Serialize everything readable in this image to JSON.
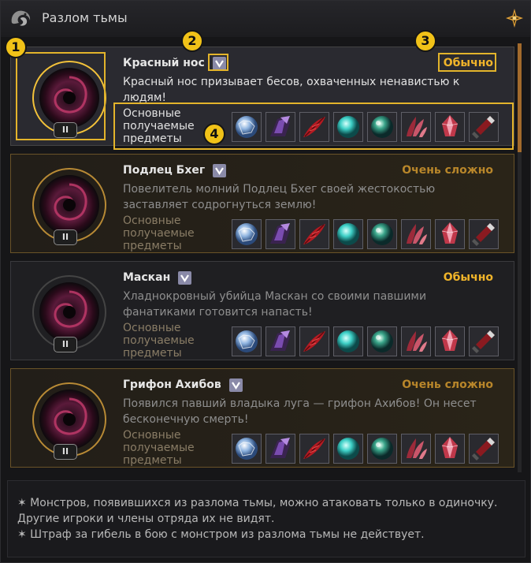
{
  "window": {
    "title": "Разлом тьмы",
    "logo_icon": "dragon-emblem-icon",
    "corner_icon": "compass-star-icon"
  },
  "colors": {
    "accent_gold": "#e3b42b",
    "normal": "#f0b42a",
    "very_hard": "#b8862a",
    "scroll": "#a26a2c"
  },
  "rewards_label": [
    "Основные",
    "получаемые",
    "предметы"
  ],
  "pause_symbol": "II",
  "reward_icons": [
    "crystal-sphere-icon",
    "dark-orb-icon",
    "red-feather-icon",
    "cyan-orb-icon",
    "green-orb-icon",
    "red-claw-icon",
    "red-crystal-icon",
    "dagger-icon"
  ],
  "bosses": [
    {
      "name": "Красный нос",
      "difficulty": "Обычно",
      "description": "Красный нос призывает бесов, охваченных ненавистью к людям!",
      "selected": true
    },
    {
      "name": "Подлец Бхег",
      "difficulty": "Очень сложно",
      "description": "Повелитель молний Подлец Бхег своей жестокостью заставляет содрогнуться землю!",
      "selected": false
    },
    {
      "name": "Маскан",
      "difficulty": "Обычно",
      "description": "Хладнокровный убийца Маскан со своими павшими фанатиками готовится напасть!",
      "selected": false
    },
    {
      "name": "Грифон Ахибов",
      "difficulty": "Очень сложно",
      "description": "Появился павший владыка луга — грифон Ахибов! Он несет бесконечную смерть!",
      "selected": false
    }
  ],
  "badges": [
    "1",
    "2",
    "3",
    "4"
  ],
  "footer": {
    "line1": "✶ Монстров, появившихся из разлома тьмы, можно атаковать только в одиночку.",
    "line2": "Другие игроки и члены отряда их не видят.",
    "line3": "✶ Штраф за гибель в бою с монстром из разлома тьмы не действует."
  }
}
